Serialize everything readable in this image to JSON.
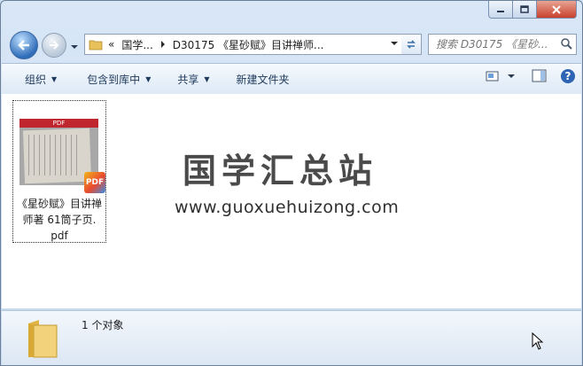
{
  "window": {
    "minimize_icon": "minimize-icon",
    "maximize_icon": "maximize-icon",
    "close_icon": "close-icon"
  },
  "address": {
    "chevron": "«",
    "crumbs": [
      "国学...",
      "D30175 《星砂赋》目讲禅师..."
    ],
    "search_placeholder": "搜索 D30175 《星砂..."
  },
  "toolbar": {
    "organize": "组织",
    "include_library": "包含到库中",
    "share": "共享",
    "new_folder": "新建文件夹"
  },
  "file": {
    "badge": "PDF",
    "thumb_header": "PDF",
    "name_line1": "《星砂赋》目讲禅",
    "name_line2": "师著 61筒子页.",
    "name_line3": "pdf"
  },
  "watermark": {
    "title": "国学汇总站",
    "url": "www.guoxuehuizong.com"
  },
  "status": {
    "count": "1 个对象"
  },
  "colors": {
    "accent": "#2f6db9",
    "close_red": "#c8412d",
    "pdf_red": "#c0262e"
  }
}
